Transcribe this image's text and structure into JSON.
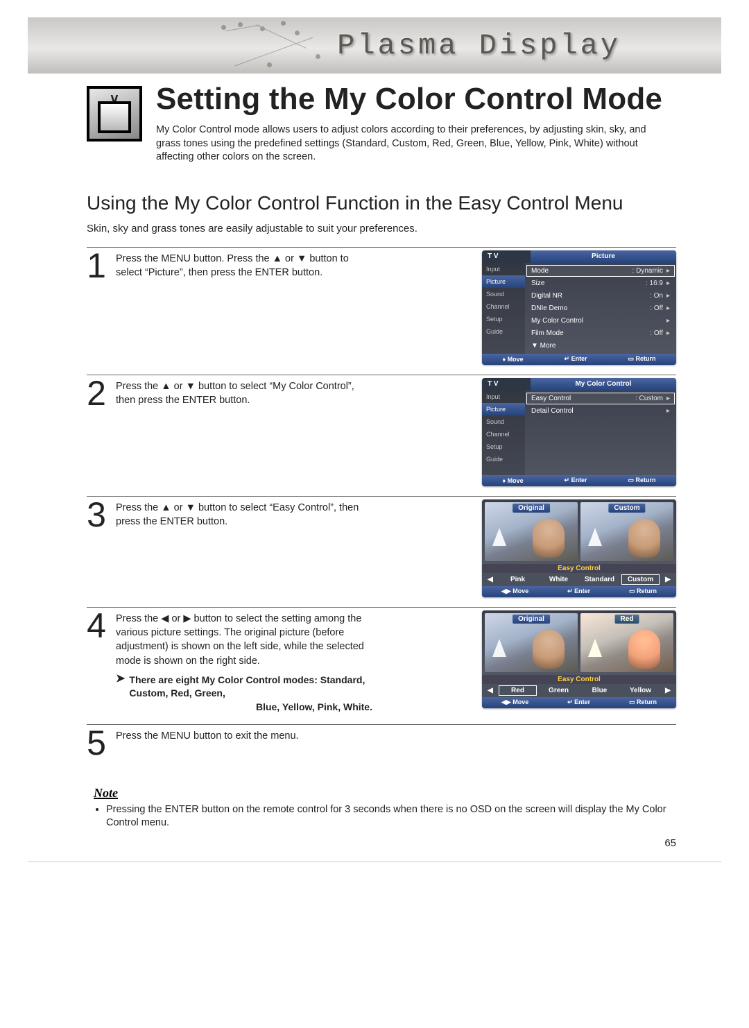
{
  "banner": {
    "title": "Plasma Display"
  },
  "heading": "Setting the My Color Control Mode",
  "intro": "My Color Control mode allows users to adjust colors according to their preferences, by adjusting skin, sky, and grass tones using the predefined settings (Standard, Custom, Red, Green, Blue, Yellow, Pink, White) without affecting other colors on the screen.",
  "section_title": "Using the My Color Control Function in the Easy Control Menu",
  "section_sub": "Skin, sky and grass tones are easily adjustable to suit your preferences.",
  "steps": {
    "s1": {
      "num": "1",
      "text": "Press the MENU button. Press the ▲ or ▼ button to select “Picture”, then press the ENTER button."
    },
    "s2": {
      "num": "2",
      "text": "Press the ▲ or ▼ button to select “My Color Control”, then press the ENTER button."
    },
    "s3": {
      "num": "3",
      "text": "Press the ▲ or ▼ button to select “Easy Control”, then press the ENTER button."
    },
    "s4": {
      "num": "4",
      "text": "Press the ◀ or ▶ button to select the setting among the various picture settings. The original picture (before adjustment) is shown on the left side, while the selected mode is shown on the right side.",
      "modes_line1": "There are eight My Color Control modes: Standard, Custom, Red, Green,",
      "modes_line2": "Blue, Yellow, Pink, White."
    },
    "s5": {
      "num": "5",
      "text": "Press the MENU button to exit the menu."
    }
  },
  "osd1": {
    "tv": "T V",
    "title": "Picture",
    "side": [
      "Input",
      "Picture",
      "Sound",
      "Channel",
      "Setup",
      "Guide"
    ],
    "rows": [
      {
        "lab": "Mode",
        "val": ": Dynamic",
        "sel": true
      },
      {
        "lab": "Size",
        "val": ": 16:9"
      },
      {
        "lab": "Digital NR",
        "val": ": On"
      },
      {
        "lab": "DNIe Demo",
        "val": ": Off"
      },
      {
        "lab": "My Color Control",
        "val": ""
      },
      {
        "lab": "Film Mode",
        "val": ": Off"
      },
      {
        "lab": "▼ More",
        "val": "",
        "nochev": true
      }
    ],
    "foot": {
      "move": "Move",
      "enter": "Enter",
      "return": "Return",
      "move_sym": "♦"
    }
  },
  "osd2": {
    "tv": "T V",
    "title": "My Color Control",
    "side": [
      "Input",
      "Picture",
      "Sound",
      "Channel",
      "Setup",
      "Guide"
    ],
    "rows": [
      {
        "lab": "Easy Control",
        "val": ": Custom",
        "sel": true
      },
      {
        "lab": "Detail Control",
        "val": ""
      }
    ],
    "foot": {
      "move": "Move",
      "enter": "Enter",
      "return": "Return",
      "move_sym": "♦"
    }
  },
  "osd3": {
    "left_label": "Original",
    "right_label": "Custom",
    "strip_title": "Easy Control",
    "strip": [
      {
        "t": "◀",
        "sel": false
      },
      {
        "t": "Pink",
        "sel": false
      },
      {
        "t": "White",
        "sel": false
      },
      {
        "t": "Standard",
        "sel": false
      },
      {
        "t": "Custom",
        "sel": true
      },
      {
        "t": "▶",
        "sel": false
      }
    ],
    "foot": {
      "move": "Move",
      "enter": "Enter",
      "return": "Return",
      "move_sym": "◀▶"
    }
  },
  "osd4": {
    "left_label": "Original",
    "right_label": "Red",
    "strip_title": "Easy Control",
    "strip": [
      {
        "t": "◀",
        "sel": false
      },
      {
        "t": "Red",
        "sel": true
      },
      {
        "t": "Green",
        "sel": false
      },
      {
        "t": "Blue",
        "sel": false
      },
      {
        "t": "Yellow",
        "sel": false
      },
      {
        "t": "▶",
        "sel": false
      }
    ],
    "foot": {
      "move": "Move",
      "enter": "Enter",
      "return": "Return",
      "move_sym": "◀▶"
    }
  },
  "note": {
    "title": "Note",
    "bullet": "Pressing the ENTER button on the remote control for 3 seconds when there is no OSD on the screen will display the My Color Control menu."
  },
  "page_number": "65"
}
